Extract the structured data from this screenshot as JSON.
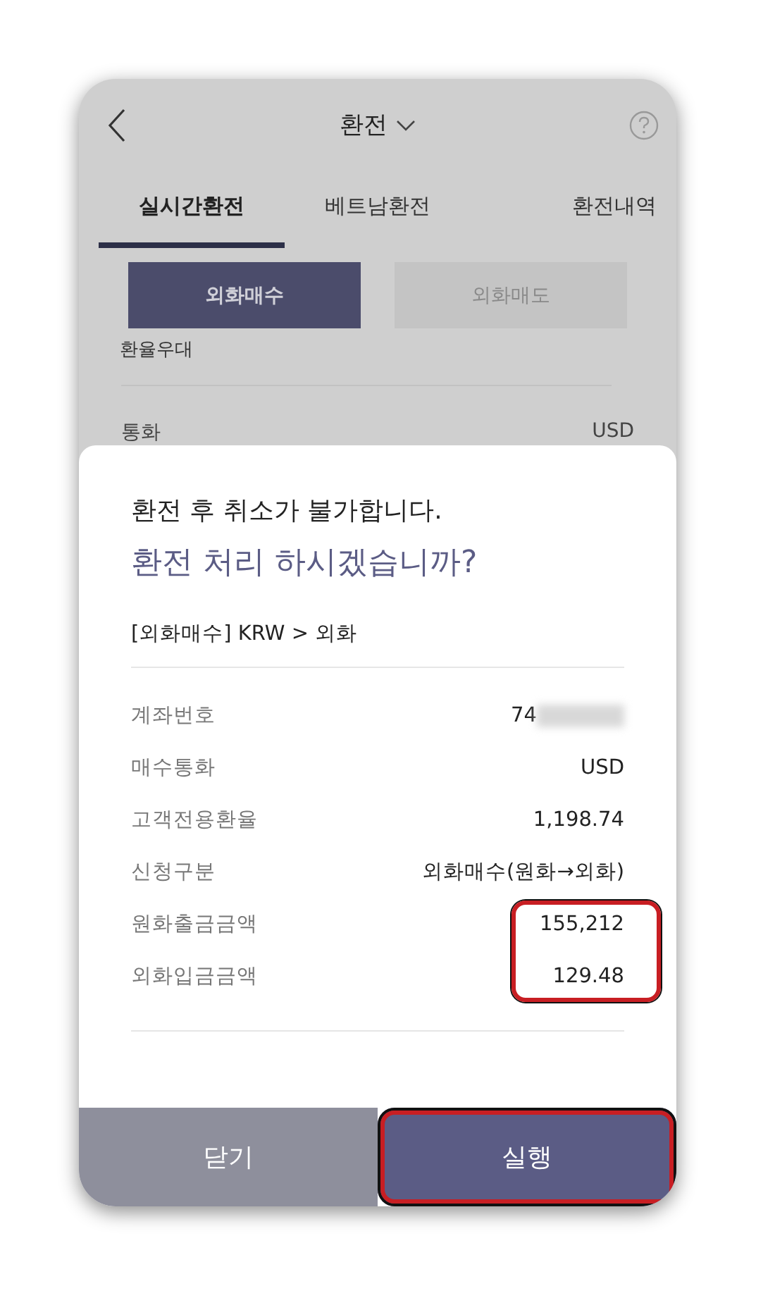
{
  "header": {
    "title": "환전"
  },
  "tabs": [
    {
      "label": "실시간환전",
      "selected": true
    },
    {
      "label": "베트남환전",
      "selected": false
    },
    {
      "label": "환전내역",
      "selected": false
    }
  ],
  "segments": [
    {
      "label": "외화매수",
      "selected": true
    },
    {
      "label": "외화매도",
      "selected": false
    }
  ],
  "section_label": "환율우대",
  "background_row": {
    "label": "통화",
    "value": "USD"
  },
  "dialog": {
    "notice": "환전 후 취소가 불가합니다.",
    "question": "환전 처리 하시겠습니까?",
    "summary": "[외화매수] KRW > 외화",
    "rows": [
      {
        "label": "계좌번호",
        "value": "74",
        "redacted": true,
        "highlighted": false
      },
      {
        "label": "매수통화",
        "value": "USD",
        "redacted": false,
        "highlighted": false
      },
      {
        "label": "고객전용환율",
        "value": "1,198.74",
        "redacted": false,
        "highlighted": false
      },
      {
        "label": "신청구분",
        "value": "외화매수(원화→외화)",
        "redacted": false,
        "highlighted": false
      },
      {
        "label": "원화출금금액",
        "value": "155,212",
        "redacted": false,
        "highlighted": true
      },
      {
        "label": "외화입금금액",
        "value": "129.48",
        "redacted": false,
        "highlighted": true
      }
    ],
    "actions": [
      {
        "label": "닫기",
        "kind": "cancel",
        "highlighted": false
      },
      {
        "label": "실행",
        "kind": "confirm",
        "highlighted": true
      }
    ]
  }
}
